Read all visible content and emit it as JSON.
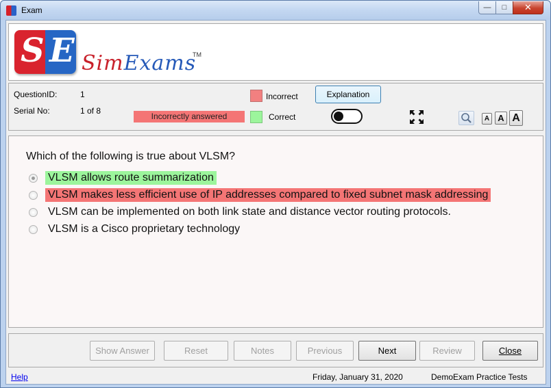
{
  "window": {
    "title": "Exam",
    "controls": {
      "minimize": "—",
      "maximize": "□",
      "close": "✕"
    }
  },
  "logo": {
    "letter_left": "S",
    "letter_right": "E",
    "name_part1": "Sim",
    "name_part2": "Exams",
    "trademark": "TM",
    "colors": {
      "red": "#d9232e",
      "blue": "#2666c4"
    }
  },
  "info": {
    "question_id_label": "QuestionID:",
    "question_id_value": "1",
    "serial_label": "Serial No:",
    "serial_value": "1 of 8",
    "status_badge": "Incorrectly answered",
    "legend_incorrect": "Incorrect",
    "legend_correct": "Correct",
    "explanation_button": "Explanation",
    "toggle_state": "off",
    "icons": [
      "fullscreen-icon",
      "search-icon"
    ],
    "font_buttons": [
      "A",
      "A",
      "A"
    ]
  },
  "question": {
    "text": "Which of the following is true about VLSM?",
    "options": [
      {
        "text": "VLSM allows route summarization",
        "state": "correct",
        "selected": true
      },
      {
        "text": "VLSM makes less efficient use of IP addresses compared to fixed subnet mask addressing",
        "state": "incorrect",
        "selected": false
      },
      {
        "text": "VLSM can be implemented on both link state and distance vector routing protocols.",
        "state": "none",
        "selected": false
      },
      {
        "text": "VLSM is a Cisco proprietary technology",
        "state": "none",
        "selected": false
      }
    ]
  },
  "nav": {
    "show_answer": "Show Answer",
    "reset": "Reset",
    "notes": "Notes",
    "previous": "Previous",
    "next": "Next",
    "review": "Review",
    "close": "Close"
  },
  "footer": {
    "help": "Help",
    "date": "Friday, January 31, 2020",
    "product": "DemoExam Practice Tests"
  },
  "colors": {
    "correct_highlight": "#9cf59c",
    "incorrect_highlight": "#f47575"
  }
}
